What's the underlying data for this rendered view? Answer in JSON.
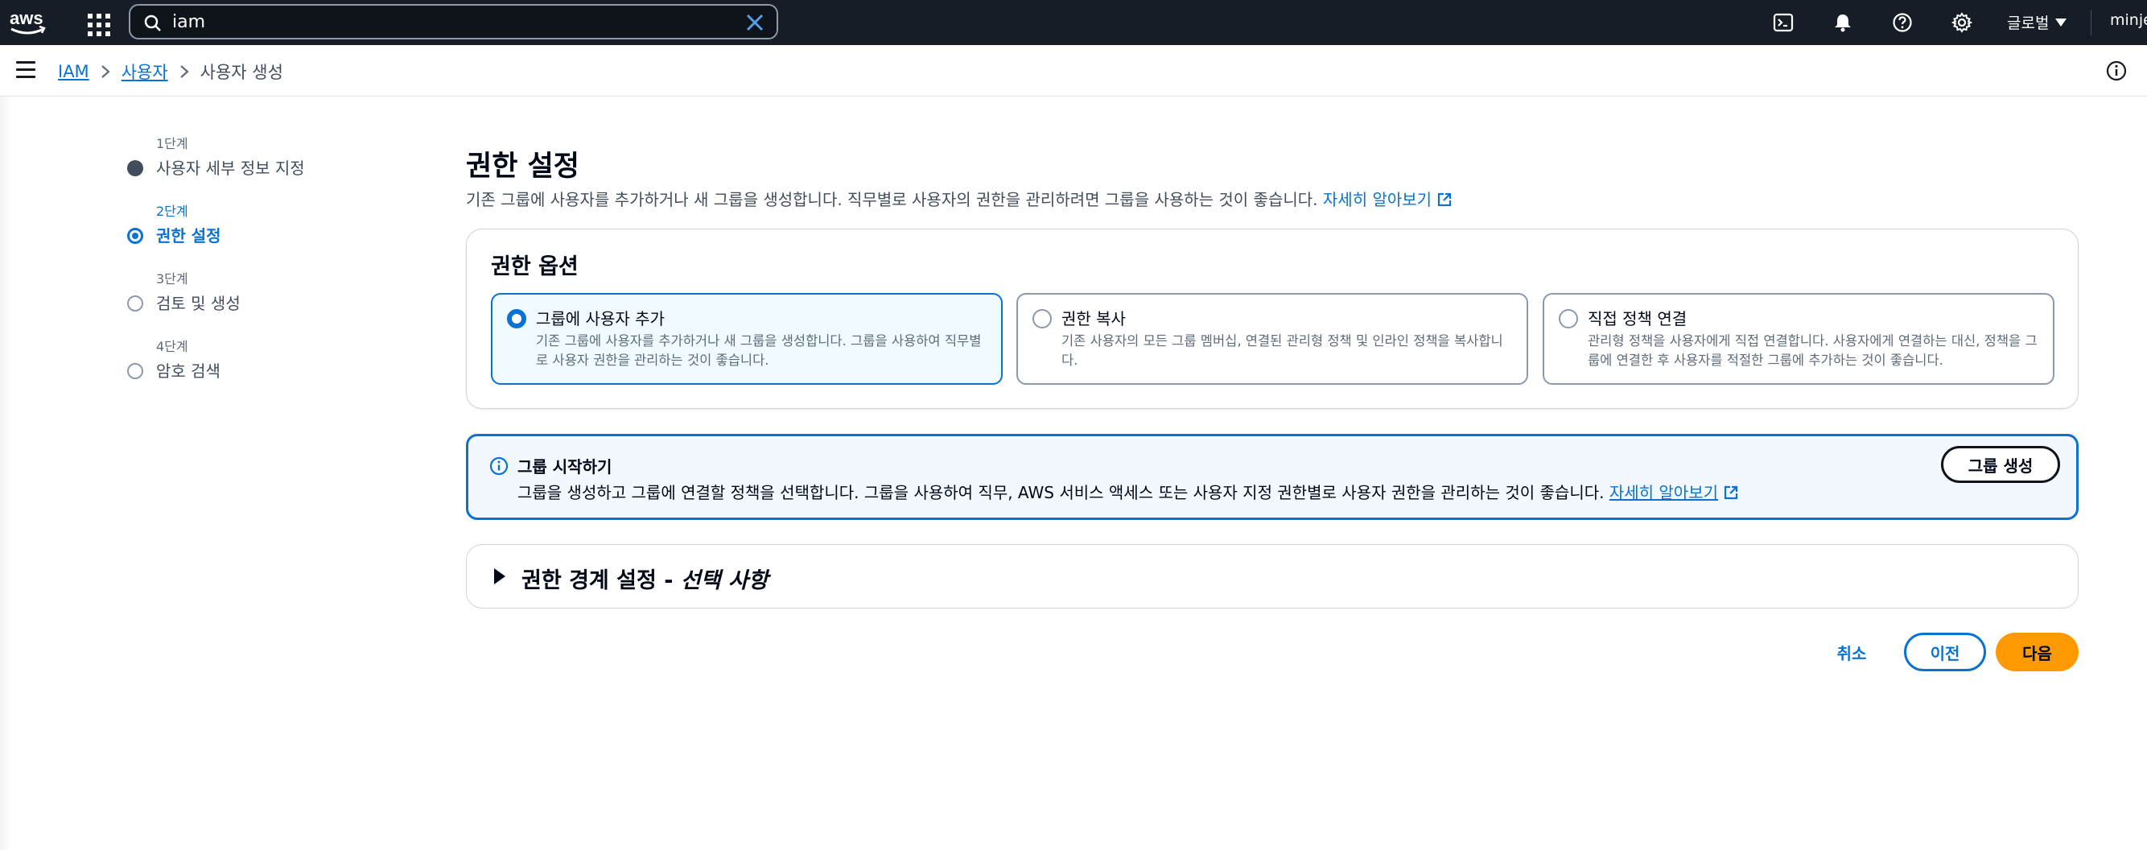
{
  "topnav": {
    "logo_text": "aws",
    "search": {
      "value": "iam",
      "placeholder": ""
    },
    "region_label": "글로벌",
    "user_label": "minjeong",
    "icons": [
      "grid-icon",
      "search-icon",
      "clear-icon",
      "cloudshell-icon",
      "bell-icon",
      "help-icon",
      "gear-icon"
    ]
  },
  "breadcrumb": {
    "items": [
      "IAM",
      "사용자"
    ],
    "current": "사용자 생성"
  },
  "steps": [
    {
      "num": "1단계",
      "title": "사용자 세부 정보 지정",
      "state": "done"
    },
    {
      "num": "2단계",
      "title": "권한 설정",
      "state": "active"
    },
    {
      "num": "3단계",
      "title": "검토 및 생성",
      "state": "todo"
    },
    {
      "num": "4단계",
      "title": "암호 검색",
      "state": "todo"
    }
  ],
  "main": {
    "title": "권한 설정",
    "description": "기존 그룹에 사용자를 추가하거나 새 그룹을 생성합니다. 직무별로 사용자의 권한을 관리하려면 그룹을 사용하는 것이 좋습니다.",
    "learn_more": "자세히 알아보기"
  },
  "permission_options": {
    "title": "권한 옵션",
    "options": [
      {
        "title": "그룹에 사용자 추가",
        "description": "기존 그룹에 사용자를 추가하거나 새 그룹을 생성합니다. 그룹을 사용하여 직무별로 사용자 권한을 관리하는 것이 좋습니다.",
        "selected": true
      },
      {
        "title": "권한 복사",
        "description": "기존 사용자의 모든 그룹 멤버십, 연결된 관리형 정책 및 인라인 정책을 복사합니다.",
        "selected": false
      },
      {
        "title": "직접 정책 연결",
        "description": "관리형 정책을 사용자에게 직접 연결합니다. 사용자에게 연결하는 대신, 정책을 그룹에 연결한 후 사용자를 적절한 그룹에 추가하는 것이 좋습니다.",
        "selected": false
      }
    ]
  },
  "alert": {
    "title": "그룹 시작하기",
    "description": "그룹을 생성하고 그룹에 연결할 정책을 선택합니다. 그룹을 사용하여 직무, AWS 서비스 액세스 또는 사용자 지정 권한별로 사용자 권한을 관리하는 것이 좋습니다.",
    "learn_more": "자세히 알아보기",
    "button": "그룹 생성"
  },
  "boundary": {
    "title": "권한 경계 설정 - ",
    "title_italic": "선택 사항"
  },
  "actions": {
    "cancel": "취소",
    "previous": "이전",
    "next": "다음"
  },
  "colors": {
    "nav_bg": "#161d26",
    "link": "#0972d3",
    "primary_button": "#ff9900",
    "selected_bg": "#f0fbff",
    "alert_bg": "#f2f8fd"
  }
}
